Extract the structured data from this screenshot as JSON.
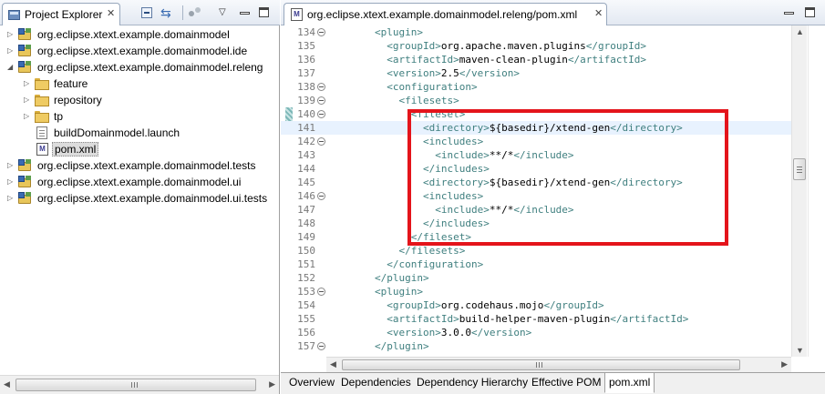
{
  "project_explorer": {
    "tab_label": "Project Explorer",
    "close_glyph": "✕",
    "toolbar": {
      "collapse_all_icon": "collapse-all-icon",
      "link_with_editor_icon": "link-with-editor-icon",
      "view_menu_glyph": "▽"
    },
    "tree": [
      {
        "label": "org.eclipse.xtext.example.domainmodel",
        "kind": "project",
        "twisty": "▷"
      },
      {
        "label": "org.eclipse.xtext.example.domainmodel.ide",
        "kind": "project",
        "twisty": "▷"
      },
      {
        "label": "org.eclipse.xtext.example.domainmodel.releng",
        "kind": "project",
        "twisty": "◢"
      },
      {
        "label": "feature",
        "kind": "folder",
        "twisty": "▷"
      },
      {
        "label": "repository",
        "kind": "folder",
        "twisty": "▷"
      },
      {
        "label": "tp",
        "kind": "folder",
        "twisty": "▷"
      },
      {
        "label": "buildDomainmodel.launch",
        "kind": "file",
        "twisty": ""
      },
      {
        "label": "pom.xml",
        "kind": "pom",
        "twisty": "",
        "selected": true
      },
      {
        "label": "org.eclipse.xtext.example.domainmodel.tests",
        "kind": "project",
        "twisty": "▷"
      },
      {
        "label": "org.eclipse.xtext.example.domainmodel.ui",
        "kind": "project",
        "twisty": "▷"
      },
      {
        "label": "org.eclipse.xtext.example.domainmodel.ui.tests",
        "kind": "project",
        "twisty": "▷"
      }
    ]
  },
  "editor": {
    "tab_label": "org.eclipse.xtext.example.domainmodel.releng/pom.xml",
    "close_glyph": "✕",
    "pom_icon_letter": "M",
    "current_line": "141",
    "lines": [
      {
        "num": "134",
        "fold": true,
        "indent": "        ",
        "parts": [
          [
            "tag",
            "<plugin>"
          ]
        ]
      },
      {
        "num": "135",
        "fold": false,
        "indent": "          ",
        "parts": [
          [
            "tag",
            "<groupId>"
          ],
          [
            "txt",
            "org.apache.maven.plugins"
          ],
          [
            "tag",
            "</groupId>"
          ]
        ]
      },
      {
        "num": "136",
        "fold": false,
        "indent": "          ",
        "parts": [
          [
            "tag",
            "<artifactId>"
          ],
          [
            "txt",
            "maven-clean-plugin"
          ],
          [
            "tag",
            "</artifactId>"
          ]
        ]
      },
      {
        "num": "137",
        "fold": false,
        "indent": "          ",
        "parts": [
          [
            "tag",
            "<version>"
          ],
          [
            "txt",
            "2.5"
          ],
          [
            "tag",
            "</version>"
          ]
        ]
      },
      {
        "num": "138",
        "fold": true,
        "indent": "          ",
        "parts": [
          [
            "tag",
            "<configuration>"
          ]
        ]
      },
      {
        "num": "139",
        "fold": true,
        "indent": "            ",
        "parts": [
          [
            "tag",
            "<filesets>"
          ]
        ]
      },
      {
        "num": "140",
        "fold": true,
        "indent": "              ",
        "parts": [
          [
            "tag",
            "<fileset>"
          ]
        ]
      },
      {
        "num": "141",
        "fold": false,
        "indent": "                ",
        "parts": [
          [
            "tag",
            "<directory>"
          ],
          [
            "txt",
            "${basedir}/xtend-gen"
          ],
          [
            "tag",
            "</directory>"
          ]
        ]
      },
      {
        "num": "142",
        "fold": true,
        "indent": "                ",
        "parts": [
          [
            "tag",
            "<includes>"
          ]
        ]
      },
      {
        "num": "143",
        "fold": false,
        "indent": "                  ",
        "parts": [
          [
            "tag",
            "<include>"
          ],
          [
            "txt",
            "**/*"
          ],
          [
            "tag",
            "</include>"
          ]
        ]
      },
      {
        "num": "144",
        "fold": false,
        "indent": "                ",
        "parts": [
          [
            "tag",
            "</includes>"
          ]
        ]
      },
      {
        "num": "145",
        "fold": false,
        "indent": "                ",
        "parts": [
          [
            "tag",
            "<directory>"
          ],
          [
            "txt",
            "${basedir}/xtend-gen"
          ],
          [
            "tag",
            "</directory>"
          ]
        ]
      },
      {
        "num": "146",
        "fold": true,
        "indent": "                ",
        "parts": [
          [
            "tag",
            "<includes>"
          ]
        ]
      },
      {
        "num": "147",
        "fold": false,
        "indent": "                  ",
        "parts": [
          [
            "tag",
            "<include>"
          ],
          [
            "txt",
            "**/*"
          ],
          [
            "tag",
            "</include>"
          ]
        ]
      },
      {
        "num": "148",
        "fold": false,
        "indent": "                ",
        "parts": [
          [
            "tag",
            "</includes>"
          ]
        ]
      },
      {
        "num": "149",
        "fold": false,
        "indent": "              ",
        "parts": [
          [
            "tag",
            "</fileset>"
          ]
        ]
      },
      {
        "num": "150",
        "fold": false,
        "indent": "            ",
        "parts": [
          [
            "tag",
            "</filesets>"
          ]
        ]
      },
      {
        "num": "151",
        "fold": false,
        "indent": "          ",
        "parts": [
          [
            "tag",
            "</configuration>"
          ]
        ]
      },
      {
        "num": "152",
        "fold": false,
        "indent": "        ",
        "parts": [
          [
            "tag",
            "</plugin>"
          ]
        ]
      },
      {
        "num": "153",
        "fold": true,
        "indent": "        ",
        "parts": [
          [
            "tag",
            "<plugin>"
          ]
        ]
      },
      {
        "num": "154",
        "fold": false,
        "indent": "          ",
        "parts": [
          [
            "tag",
            "<groupId>"
          ],
          [
            "txt",
            "org.codehaus.mojo"
          ],
          [
            "tag",
            "</groupId>"
          ]
        ]
      },
      {
        "num": "155",
        "fold": false,
        "indent": "          ",
        "parts": [
          [
            "tag",
            "<artifactId>"
          ],
          [
            "txt",
            "build-helper-maven-plugin"
          ],
          [
            "tag",
            "</artifactId>"
          ]
        ]
      },
      {
        "num": "156",
        "fold": false,
        "indent": "          ",
        "parts": [
          [
            "tag",
            "<version>"
          ],
          [
            "txt",
            "3.0.0"
          ],
          [
            "tag",
            "</version>"
          ]
        ]
      },
      {
        "num": "157",
        "fold": true,
        "indent": "        ",
        "parts": [
          [
            "tag",
            "</plugin>"
          ]
        ]
      }
    ],
    "colors": {
      "tag": "#3f7f7f",
      "text": "#000000",
      "highlight_border": "#e4141b",
      "current_line": "#e8f2fe"
    }
  },
  "scroll_arrows": {
    "left": "◀",
    "right": "▶",
    "up": "▲",
    "down": "▼"
  },
  "page_tabs": [
    {
      "label": "Overview",
      "active": false
    },
    {
      "label": "Dependencies",
      "active": false
    },
    {
      "label": "Dependency Hierarchy",
      "active": false
    },
    {
      "label": "Effective POM",
      "active": false
    },
    {
      "label": "pom.xml",
      "active": true
    }
  ]
}
